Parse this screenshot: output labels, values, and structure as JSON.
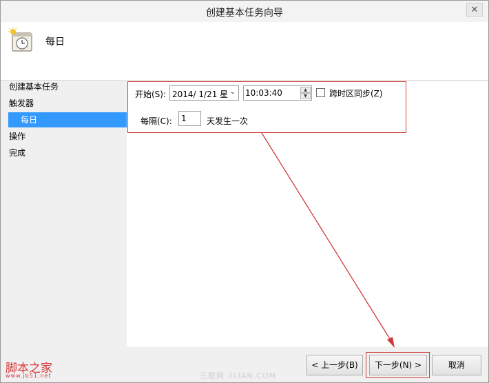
{
  "window": {
    "title": "创建基本任务向导",
    "close_glyph": "✕"
  },
  "header": {
    "icon": "calendar-clock-icon",
    "title": "每日"
  },
  "sidebar": {
    "items": [
      {
        "label": "创建基本任务",
        "selected": false
      },
      {
        "label": "触发器",
        "selected": false
      },
      {
        "label": "每日",
        "selected": true
      },
      {
        "label": "操作",
        "selected": false
      },
      {
        "label": "完成",
        "selected": false
      }
    ]
  },
  "form": {
    "start_label": "开始(S):",
    "start_date": "2014/  1/21 星",
    "dropdown_arrow": "⌄",
    "start_time": "10:03:40",
    "spin_up": "▲",
    "spin_down": "▼",
    "sync_tz_label": "跨时区同步(Z)",
    "sync_tz_checked": false,
    "every_label": "每隔(C):",
    "every_value": "1",
    "every_suffix": "天发生一次"
  },
  "footer": {
    "back_label": "< 上一步(B)",
    "next_label": "下一步(N) >",
    "cancel_label": "取消"
  },
  "watermarks": {
    "logo_text": "脚本之家",
    "site_text": "www.jb51.net",
    "faint_text": "三联网 3LIAN.COM"
  },
  "colors": {
    "selection_blue": "#3399ff",
    "annotation_red": "#d13a3a"
  }
}
